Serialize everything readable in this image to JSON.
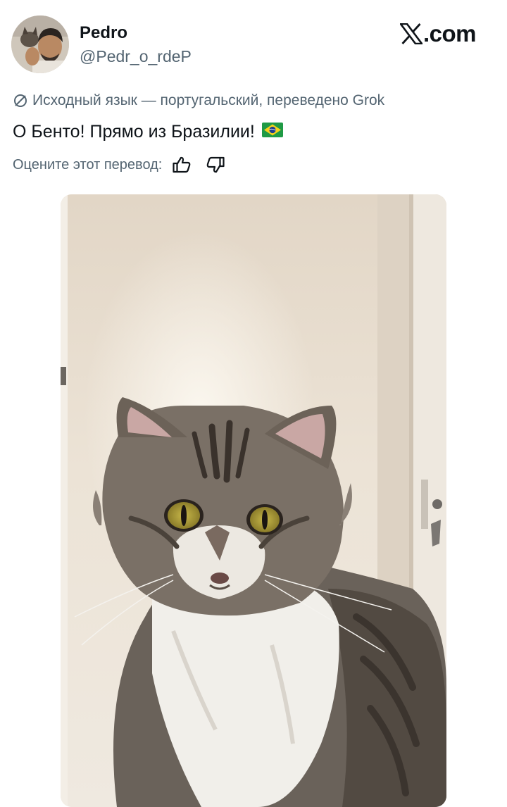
{
  "author": {
    "display_name": "Pedro",
    "handle": "@Pedr_o_rdeP",
    "avatar_icon": "profile-photo"
  },
  "brand": {
    "site": ".com",
    "logo_icon": "x-logo-icon"
  },
  "translation": {
    "notice": "Исходный язык — португальский, переведено Grok",
    "icon": "translate-icon"
  },
  "tweet": {
    "text": "О Бенто! Прямо из Бразилии!",
    "emoji": "brazil-flag-icon"
  },
  "rating": {
    "prompt": "Оцените этот перевод:",
    "like_icon": "thumbs-up-icon",
    "dislike_icon": "thumbs-down-icon"
  },
  "media": {
    "type": "photo",
    "subject": "tabby-cat-photo"
  },
  "colors": {
    "text_primary": "#0f1419",
    "text_secondary": "#536471",
    "background": "#ffffff"
  }
}
